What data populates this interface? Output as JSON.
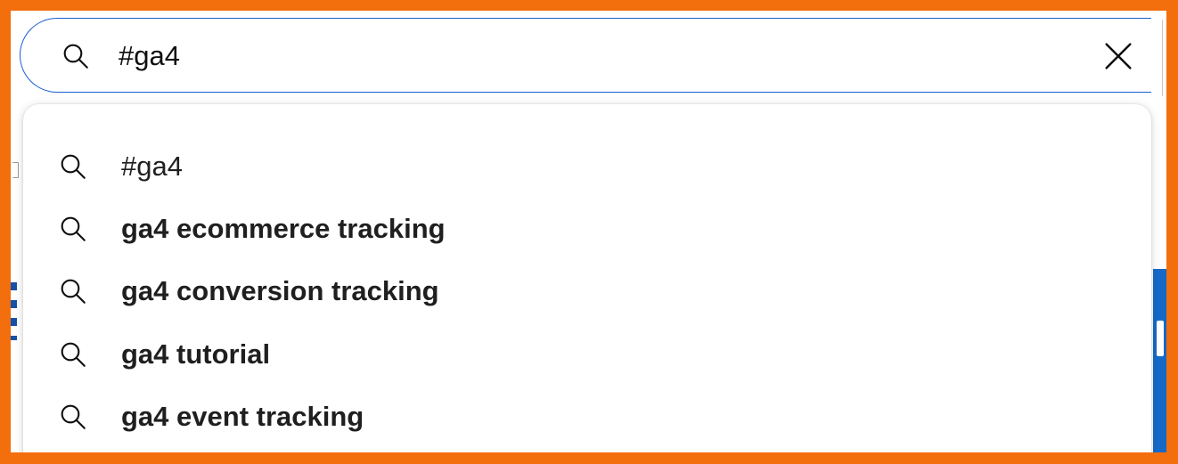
{
  "search": {
    "value": "#ga4",
    "icon": "search-icon",
    "clear_icon": "close-icon"
  },
  "suggestions": [
    {
      "label": "#ga4",
      "bold": false,
      "icon": "search-icon"
    },
    {
      "label": "ga4 ecommerce tracking",
      "bold": true,
      "icon": "search-icon"
    },
    {
      "label": "ga4 conversion tracking",
      "bold": true,
      "icon": "search-icon"
    },
    {
      "label": "ga4 tutorial",
      "bold": true,
      "icon": "search-icon"
    },
    {
      "label": "ga4 event tracking",
      "bold": true,
      "icon": "search-icon"
    }
  ],
  "colors": {
    "frame_border": "#f36e0d",
    "focus_ring": "#1a5fd0",
    "text": "#1f1f1f",
    "background_accent": "#1669c7"
  }
}
